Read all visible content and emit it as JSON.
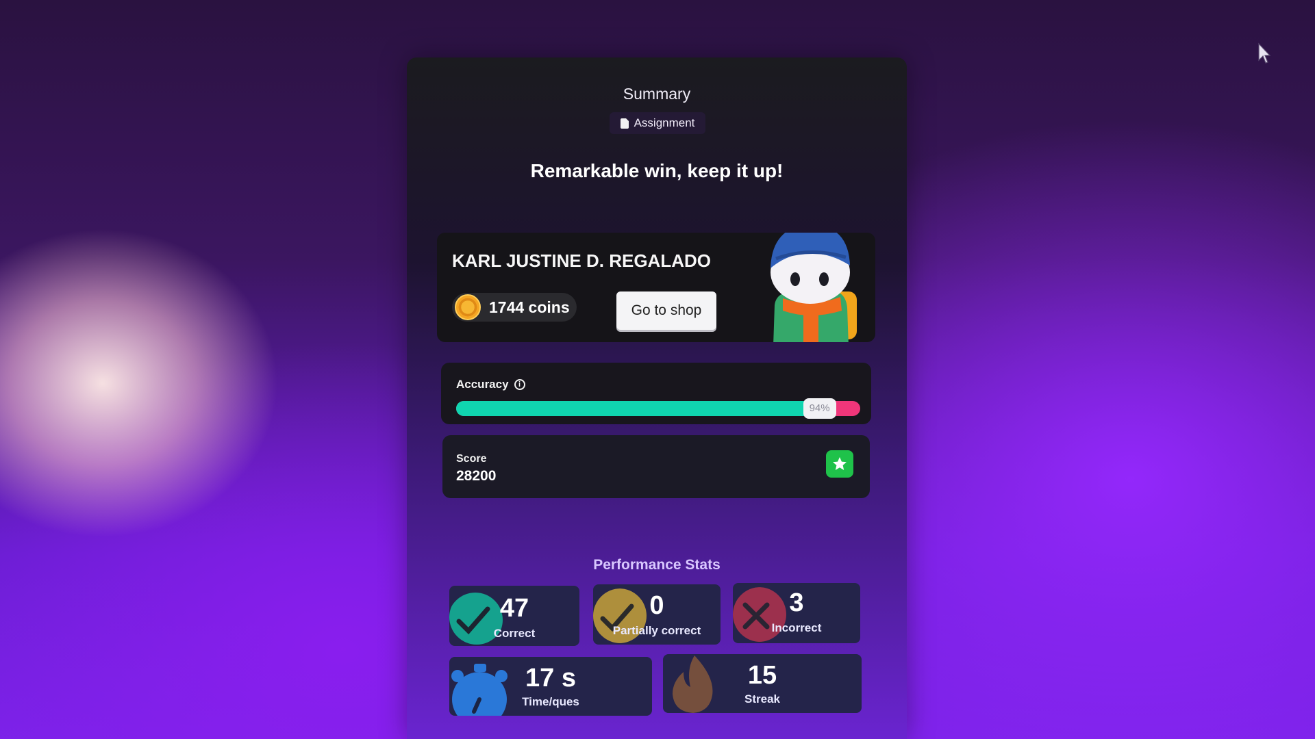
{
  "summary": {
    "title": "Summary",
    "badge": {
      "icon": "document-icon",
      "label": "Assignment"
    },
    "headline": "Remarkable win, keep it up!"
  },
  "player": {
    "name": "KARL JUSTINE D. REGALADO",
    "coins_label": "1744 coins",
    "coin_icon": "coin-icon",
    "shop_button": "Go to shop",
    "mascot": "mascot-character"
  },
  "accuracy": {
    "label": "Accuracy",
    "info_icon": "info-icon",
    "percent_label": "94%",
    "value": 0.94,
    "fill_color": "#10d5b0",
    "remainder_color": "#f0367a"
  },
  "score": {
    "label": "Score",
    "value": "28200",
    "icon": "star-icon",
    "icon_color": "#1fc24a"
  },
  "performance": {
    "title": "Performance Stats",
    "stats": [
      {
        "value": "47",
        "label": "Correct",
        "icon": "check-icon",
        "color": "#13b89a"
      },
      {
        "value": "0",
        "label": "Partially correct",
        "icon": "check-icon",
        "color": "#c7a23a"
      },
      {
        "value": "3",
        "label": "Incorrect",
        "icon": "x-icon",
        "color": "#b2324e"
      },
      {
        "value": "17 s",
        "label": "Time/ques",
        "icon": "stopwatch-icon",
        "color": "#2a78d8"
      },
      {
        "value": "15",
        "label": "Streak",
        "icon": "flame-icon",
        "color": "#8a5a3a"
      }
    ]
  }
}
